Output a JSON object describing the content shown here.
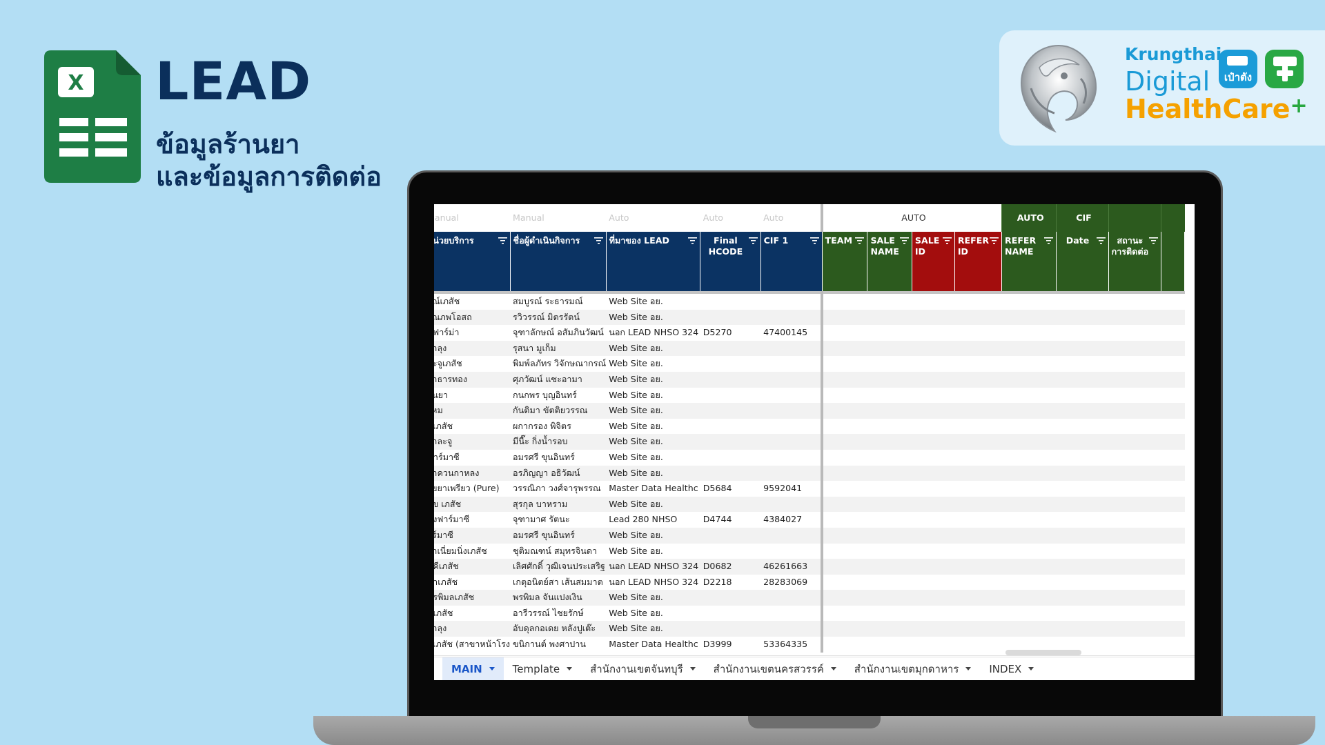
{
  "title": "LEAD",
  "subtitle": [
    "ข้อมูลร้านยา",
    "และข้อมูลการติดต่อ"
  ],
  "brand": {
    "line1": "Krungthai",
    "line2": "Digital",
    "line3": "HealthCare",
    "plus": "+",
    "app_pao": "เป๋าตัง"
  },
  "sheet": {
    "hints": [
      "Manual",
      "Manual",
      "Auto",
      "Auto",
      "Auto",
      "AUTO",
      "AUTO",
      "CIF"
    ],
    "headers": [
      "หน่วยบริการ",
      "ชื่อผู้ดำเนินกิจการ",
      "ที่มาของ LEAD",
      "Final HCODE",
      "CIF 1",
      "TEAM",
      "SALE NAME",
      "SALE ID",
      "REFER ID",
      "REFER NAME",
      "Date",
      "สถานะการติดต่อ"
    ],
    "rows": [
      [
        "รณ์เภสัช",
        "สมบูรณ์ ระธารมณ์",
        "Web Site อย.",
        "",
        ""
      ],
      [
        "รณภพโอสถ",
        "รวิวรรณ์ มิตรรัตน์",
        "Web Site อย.",
        "",
        ""
      ],
      [
        "พี่ฟาร์ม่า",
        "จุฑาลักษณ์ อสัมภินวัฒน์",
        "นอก LEAD NHSO 324",
        "D5270",
        "47400145"
      ],
      [
        "ยาลุง",
        "รุสนา มูเก็ม",
        "Web Site อย.",
        "",
        ""
      ],
      [
        "ละจูเภสัช",
        "พิมพ์ลภัทร วิจักษณากรณ์",
        "Web Site อย.",
        "",
        ""
      ],
      [
        "ยาธารทอง",
        "ศุภวัฒน์ แซะอามา",
        "Web Site อย.",
        "",
        ""
      ],
      [
        "านยา",
        "กนกพร บุญอินทร์",
        "Web Site อย.",
        "",
        ""
      ],
      [
        "ใหม",
        "กันติมา ขัตติยวรรณ",
        "Web Site อย.",
        "",
        ""
      ],
      [
        "ภูเภสัช",
        "ผกากรอง พิจิตร",
        "Web Site อย.",
        "",
        ""
      ],
      [
        "ยาละจู",
        "มีนี๊ะ กิ่งน้ำรอบ",
        "Web Site อย.",
        "",
        ""
      ],
      [
        "ฟาร์มาซี",
        "อมรศรี ขุนอินทร์",
        "Web Site อย.",
        "",
        ""
      ],
      [
        "ยาควนกาหลง",
        "อรภิญญา อธิวัฒน์",
        "Web Site อย.",
        "",
        ""
      ],
      [
        "ายยาเพรียว (Pure)",
        "วรรณิภา วงศ์จารุพรรณ",
        "Master Data Healthc",
        "D5684",
        "9592041"
      ],
      [
        "สุข เภสัช",
        "สุรกุล บาหราม",
        "Web Site อย.",
        "",
        ""
      ],
      [
        "พงฟาร์มาซี",
        "จุฑามาศ รัตนะ",
        "Lead 280 NHSO",
        "D4744",
        "4384027"
      ],
      [
        "าร์มาซี",
        "อมรศรี ขุนอินทร์",
        "Web Site อย.",
        "",
        ""
      ],
      [
        "ยาเนี่ยมนิ่งเภสัช",
        "ชุติมณฑน์ สมุทรจินดา",
        "Web Site อย.",
        "",
        ""
      ],
      [
        "คคีเภสัช",
        "เลิศศักดิ์ วุฒิเจนประเสริฐ",
        "นอก LEAD NHSO 324",
        "D0682",
        "46261663"
      ],
      [
        "ดาเภสัช",
        "เกตุอนิตย์สา เส้นสมมาต",
        "นอก LEAD NHSO 324",
        "D2218",
        "28283069"
      ],
      [
        "พรพิมลเภสัช",
        "พรพิมล จันแปงเงิน",
        "Web Site อย.",
        "",
        ""
      ],
      [
        "นเภสัช",
        "อารีวรรณ์ ไชยรักษ์",
        "Web Site อย.",
        "",
        ""
      ],
      [
        "ยาลุง",
        "อับดุลกอเดย หลังปูเต๊ะ",
        "Web Site อย.",
        "",
        ""
      ],
      [
        "ต์เภสัช (สาขาหน้าโรง",
        "ขนิกานต์ พงศาปาน",
        "Master Data Healthc",
        "D3999",
        "53364335"
      ]
    ]
  },
  "tabs": [
    {
      "label": "MAIN",
      "active": true
    },
    {
      "label": "Template"
    },
    {
      "label": "สำนักงานเขตจันทบุรี"
    },
    {
      "label": "สำนักงานเขตนครสวรรค์"
    },
    {
      "label": "สำนักงานเขตมุกดาหาร"
    },
    {
      "label": "INDEX"
    }
  ],
  "colors": {
    "background": "#b3def4",
    "title": "#0b2f5b",
    "header_navy": "#0b3363",
    "header_green": "#2c5a1e",
    "header_red": "#a30d0d",
    "sheets_green": "#1e7e45",
    "brand_blue": "#1a9ad6",
    "brand_orange": "#f5a100"
  },
  "icons": [
    "google-sheets-icon",
    "krungthai-emblem-icon",
    "pao-tang-app-icon",
    "health-app-icon",
    "filter-icon",
    "dropdown-arrow-icon"
  ]
}
